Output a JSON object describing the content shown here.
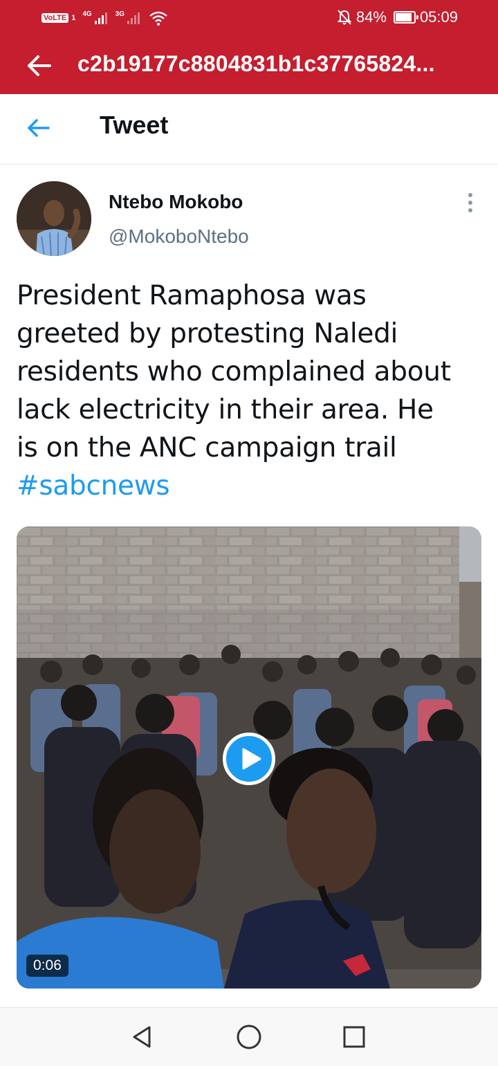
{
  "status_bar": {
    "volte": "VoLTE",
    "sim": "1",
    "net1": "4G",
    "net2": "3G",
    "battery": "84%",
    "time": "05:09"
  },
  "app_bar": {
    "title": "c2b19177c8804831b1c37765824..."
  },
  "header": {
    "title": "Tweet"
  },
  "tweet": {
    "author_name": "Ntebo Mokobo",
    "author_handle": "@MokoboNtebo",
    "text_lines": [
      "President Ramaphosa was",
      "greeted by protesting Naledi",
      "residents who complained about",
      "lack electricity in their area. He",
      "is on the ANC campaign trail"
    ],
    "hashtag": "#sabcnews",
    "video_duration": "0:06"
  },
  "icons": {
    "app_back": "arrow-left-icon",
    "tweet_back": "arrow-left-icon",
    "more": "more-vertical-icon",
    "play": "play-icon",
    "nav_back": "triangle-back-icon",
    "nav_home": "circle-home-icon",
    "nav_recents": "square-recents-icon"
  },
  "colors": {
    "brand_red": "#c41e2f",
    "twitter_blue": "#1d9bf0",
    "text_primary": "#0f1419",
    "text_secondary": "#5b7083"
  }
}
